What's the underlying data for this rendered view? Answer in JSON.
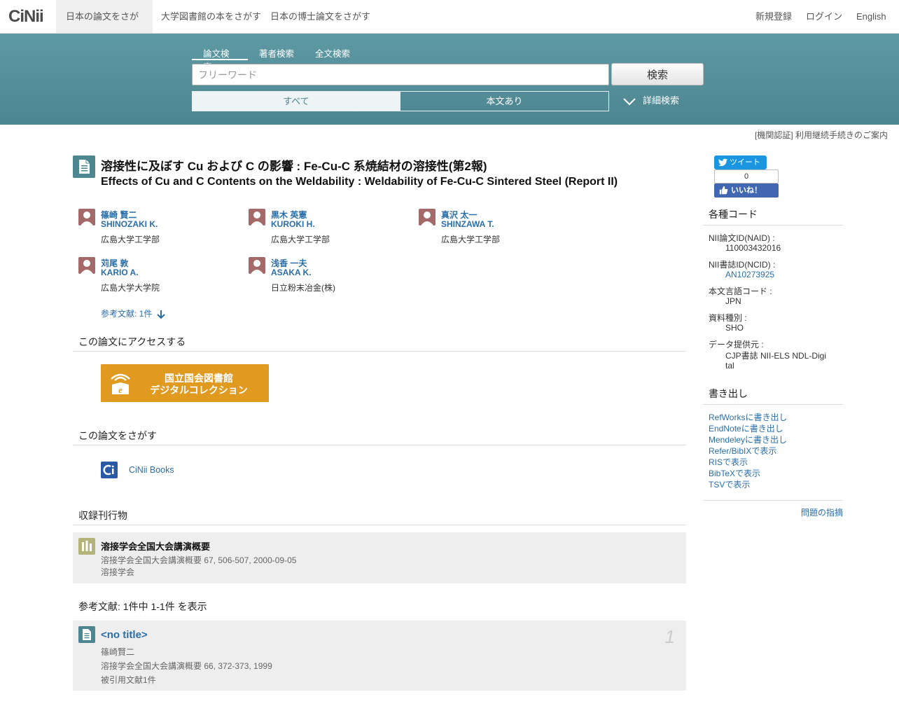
{
  "nav": {
    "logo": "CiNii",
    "tabs": [
      "日本の論文をさがす",
      "大学図書館の本をさがす",
      "日本の博士論文をさがす"
    ],
    "right": [
      "新規登録",
      "ログイン",
      "English"
    ]
  },
  "search": {
    "tabs": [
      "論文検索",
      "著者検索",
      "全文検索"
    ],
    "placeholder": "フリーワード",
    "button": "検索",
    "filter_all": "すべて",
    "filter_body": "本文あり",
    "advanced": "詳細検索"
  },
  "notice": "[機関認証] 利用継続手続きのご案内",
  "article": {
    "title_ja": "溶接性に及ぼす Cu および C の影響 : Fe-Cu-C 系焼結材の溶接性(第2報)",
    "title_en": "Effects of Cu and C Contents on the Weldability : Weldability of Fe-Cu-C Sintered Steel (Report II)"
  },
  "authors": [
    {
      "name_ja": "篠崎 賢二",
      "name_en": "SHINOZAKI K.",
      "aff": "広島大学工学部"
    },
    {
      "name_ja": "黒木 英憲",
      "name_en": "KUROKI H.",
      "aff": "広島大学工学部"
    },
    {
      "name_ja": "真沢 太一",
      "name_en": "SHINZAWA T.",
      "aff": "広島大学工学部"
    },
    {
      "name_ja": "苅尾 敦",
      "name_en": "KARIO A.",
      "aff": "広島大学大学院"
    },
    {
      "name_ja": "浅香 一夫",
      "name_en": "ASAKA K.",
      "aff": "日立粉末冶金(株)"
    }
  ],
  "refs_link": "参考文献: 1件",
  "access": {
    "heading": "この論文にアクセスする",
    "ndl_line1": "国立国会図書館",
    "ndl_line2": "デジタルコレクション"
  },
  "find": {
    "heading": "この論文をさがす",
    "cinii_books": "CiNii Books"
  },
  "journal": {
    "heading": "収録刊行物",
    "title": "溶接学会全国大会講演概要",
    "detail": "溶接学会全国大会講演概要 67, 506-507, 2000-09-05",
    "publisher": "溶接学会"
  },
  "references": {
    "heading": "参考文献:  1件中 1-1件 を表示",
    "items": [
      {
        "num": "1",
        "title": "<no title>",
        "author": "篠崎賢二",
        "detail": "溶接学会全国大会講演概要 66, 372-373, 1999",
        "cited": "被引用文献1件"
      }
    ]
  },
  "sidebar": {
    "tweet": "ツイート",
    "fb_count": "0",
    "fb_like": "いいね！",
    "codes_heading": "各種コード",
    "codes": [
      {
        "label": "NII論文ID(NAID) :",
        "value": "110003432016",
        "link": false
      },
      {
        "label": "NII書誌ID(NCID) :",
        "value": "AN10273925",
        "link": true
      },
      {
        "label": "本文言語コード :",
        "value": "JPN",
        "link": false
      },
      {
        "label": "資料種別 :",
        "value": "SHO",
        "link": false
      },
      {
        "label": "データ提供元 :",
        "value": "CJP書誌  NII-ELS  NDL-Digi",
        "value2": "tal",
        "link": false
      }
    ],
    "export_heading": "書き出し",
    "export": [
      "RefWorksに書き出し",
      "EndNoteに書き出し",
      "Mendeleyに書き出し",
      "Refer/BibIXで表示",
      "RISで表示",
      "BibTeXで表示",
      "TSVで表示"
    ],
    "report": "問題の指摘"
  },
  "colors": {
    "teal": "#4d8590",
    "link": "#2a6ea8",
    "ndl": "#e09a1f"
  }
}
